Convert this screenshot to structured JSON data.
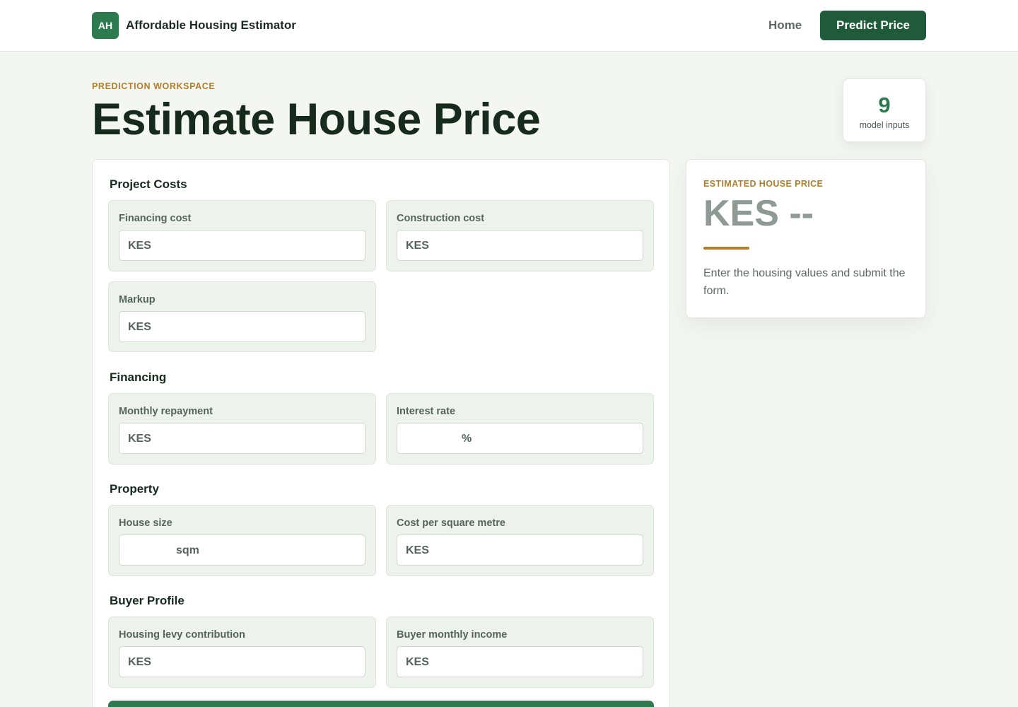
{
  "header": {
    "logo_text": "AH",
    "app_name": "Affordable Housing Estimator",
    "nav_home": "Home",
    "nav_predict": "Predict Price"
  },
  "hero": {
    "eyebrow": "PREDICTION WORKSPACE",
    "title": "Estimate House Price",
    "stat_value": "9",
    "stat_label": "model inputs"
  },
  "form": {
    "sections": {
      "project_costs": "Project Costs",
      "financing": "Financing",
      "property": "Property",
      "buyer_profile": "Buyer Profile"
    },
    "fields": {
      "financing_cost": {
        "label": "Financing cost",
        "unit": "KES"
      },
      "construction_cost": {
        "label": "Construction cost",
        "unit": "KES"
      },
      "markup": {
        "label": "Markup",
        "unit": "KES"
      },
      "monthly_repayment": {
        "label": "Monthly repayment",
        "unit": "KES"
      },
      "interest_rate": {
        "label": "Interest rate",
        "unit": "%"
      },
      "house_size": {
        "label": "House size",
        "unit": "sqm"
      },
      "cost_per_sqm": {
        "label": "Cost per square metre",
        "unit": "KES"
      },
      "housing_levy": {
        "label": "Housing levy contribution",
        "unit": "KES"
      },
      "buyer_income": {
        "label": "Buyer monthly income",
        "unit": "KES"
      }
    }
  },
  "result": {
    "eyebrow": "ESTIMATED HOUSE PRICE",
    "price": "KES --",
    "message": "Enter the housing values and submit the form."
  },
  "colors": {
    "brand": "#2e7a4f",
    "brand_dark": "#1f5a3a",
    "accent": "#b07f2c",
    "background": "#f4f6f1"
  }
}
